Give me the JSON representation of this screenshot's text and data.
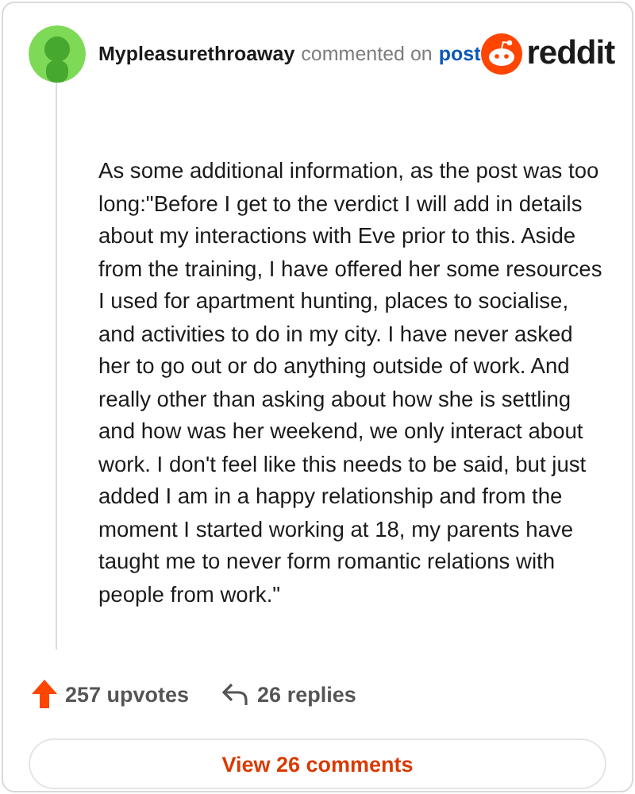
{
  "comment": {
    "author": "Mypleasurethroaway",
    "action": "commented on",
    "link": "post",
    "brand": "reddit",
    "body": "As some additional information, as the post was too long:\"Before I get to the verdict I will add in details about my interactions with Eve prior to this. Aside from the training, I have offered her some resources I used for apartment hunting, places to socialise, and activities to do in my city. I have never asked her to go out or do anything outside of work. And really other than asking about how she is settling and how was her weekend, we only interact about work. I don't feel like this needs to be said, but just added I am in a happy relationship and from the moment I started working at 18, my parents have taught me to never form romantic relations with people from work.\""
  },
  "stats": {
    "upvotes": "257 upvotes",
    "replies": "26 replies"
  },
  "button": "View 26 comments"
}
